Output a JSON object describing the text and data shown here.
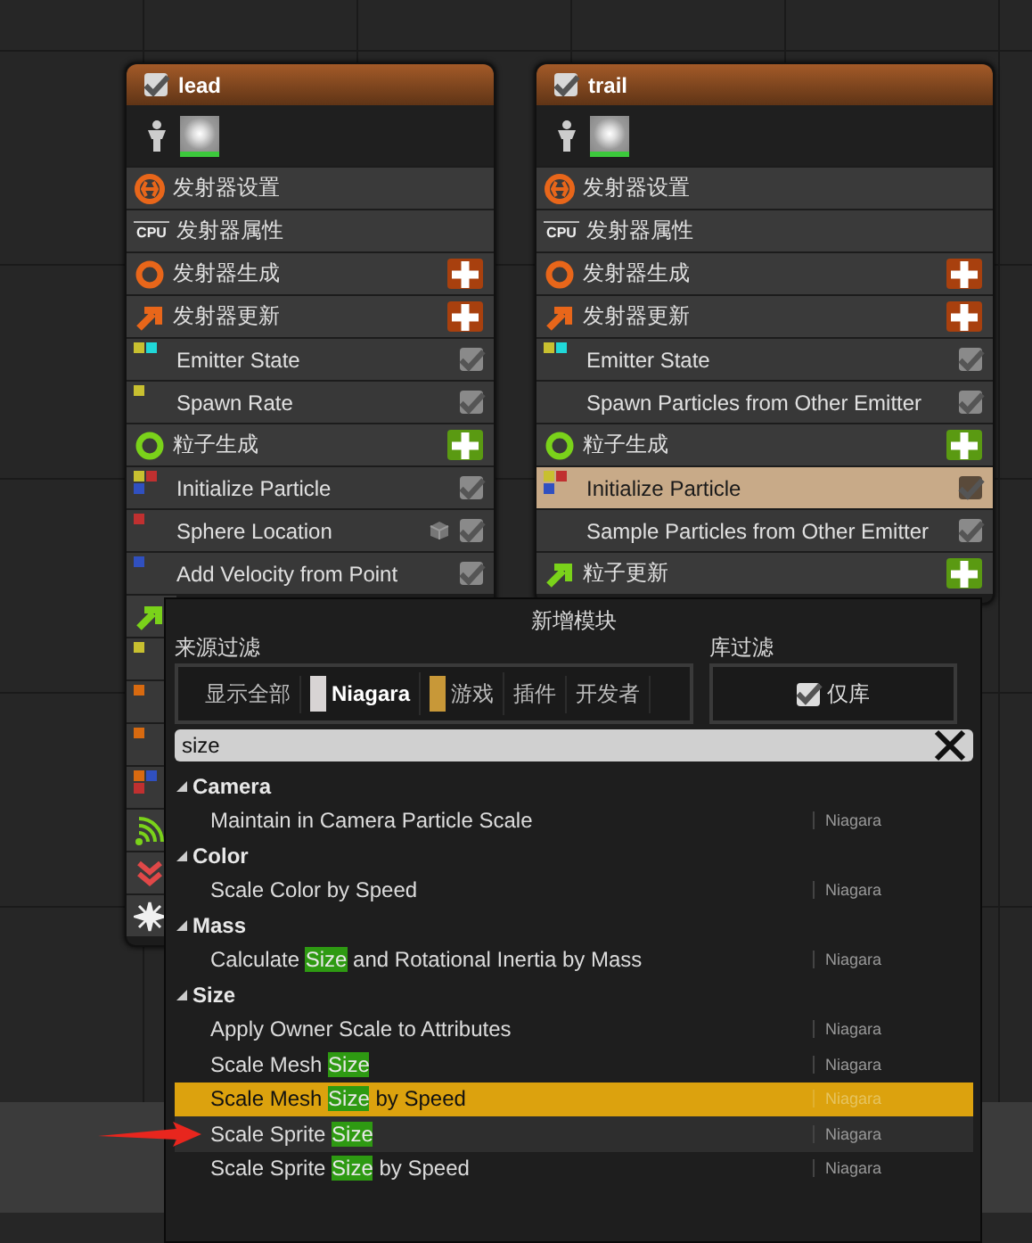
{
  "emitters": [
    {
      "name": "lead",
      "enabled": true,
      "rows": [
        {
          "kind": "settings",
          "label": "发射器设置",
          "color": "#e8661a"
        },
        {
          "kind": "properties",
          "badge": "CPU",
          "label": "发射器属性"
        },
        {
          "kind": "spawn",
          "label": "发射器生成",
          "color": "#e8661a",
          "add": true
        },
        {
          "kind": "update",
          "label": "发射器更新",
          "color": "#e8661a",
          "add": true
        },
        {
          "kind": "module",
          "label": "Emitter State",
          "dots": [
            {
              "color": "#c8c030"
            },
            {
              "color": "#20d8d8"
            }
          ],
          "checked": true
        },
        {
          "kind": "module",
          "label": "Spawn Rate",
          "dots": [
            {
              "color": "#c8c030"
            }
          ],
          "checked": true
        },
        {
          "kind": "spawn",
          "label": "粒子生成",
          "color": "#7ad21a",
          "add": true
        },
        {
          "kind": "module",
          "label": "Initialize Particle",
          "dots": [
            {
              "color": "#c8c030"
            },
            {
              "color": "#c03030"
            },
            {
              "color": "#3050c0"
            }
          ],
          "checked": true
        },
        {
          "kind": "module",
          "label": "Sphere Location",
          "dots": [
            {
              "color": "#c03030"
            }
          ],
          "checked": true,
          "mesh": true
        },
        {
          "kind": "module",
          "label": "Add Velocity from Point",
          "dots": [
            {
              "color": "#3050c0"
            }
          ],
          "checked": true
        },
        {
          "kind": "update",
          "color": "#7ad21a"
        },
        {
          "kind": "module",
          "dots": [
            {
              "color": "#c8c030"
            }
          ]
        },
        {
          "kind": "module",
          "dots": [
            {
              "color": "#d86a10"
            }
          ]
        },
        {
          "kind": "module",
          "dots": [
            {
              "color": "#d86a10"
            }
          ]
        },
        {
          "kind": "module",
          "dots": [
            {
              "color": "#d86a10"
            },
            {
              "color": "#3050c0"
            },
            {
              "color": "#c03030"
            }
          ]
        },
        {
          "kind": "sensor",
          "color": "#7ad21a"
        },
        {
          "kind": "chevron",
          "color": "#e04848"
        },
        {
          "kind": "burst",
          "color": "#f0f0f0"
        }
      ]
    },
    {
      "name": "trail",
      "enabled": true,
      "rows": [
        {
          "kind": "settings",
          "label": "发射器设置",
          "color": "#e8661a"
        },
        {
          "kind": "properties",
          "badge": "CPU",
          "label": "发射器属性"
        },
        {
          "kind": "spawn",
          "label": "发射器生成",
          "color": "#e8661a",
          "add": true
        },
        {
          "kind": "update",
          "label": "发射器更新",
          "color": "#e8661a",
          "add": true
        },
        {
          "kind": "module",
          "label": "Emitter State",
          "dots": [
            {
              "color": "#c8c030"
            },
            {
              "color": "#20d8d8"
            }
          ],
          "checked": true
        },
        {
          "kind": "module",
          "label": "Spawn Particles from Other Emitter",
          "checked": true
        },
        {
          "kind": "spawn",
          "label": "粒子生成",
          "color": "#7ad21a",
          "add": true
        },
        {
          "kind": "module",
          "label": "Initialize Particle",
          "dots": [
            {
              "color": "#c8c030"
            },
            {
              "color": "#c03030"
            },
            {
              "color": "#3050c0"
            }
          ],
          "checked": true,
          "selected": true
        },
        {
          "kind": "module",
          "label": "Sample Particles from Other Emitter",
          "checked": true
        },
        {
          "kind": "update",
          "label": "粒子更新",
          "color": "#7ad21a",
          "add": true
        }
      ]
    }
  ],
  "popup": {
    "title": "新增模块",
    "source_filter_label": "来源过滤",
    "library_filter_label": "库过滤",
    "source_filters": [
      {
        "label": "显示全部",
        "selected": false
      },
      {
        "label": "Niagara",
        "selected": true,
        "color": "#d8d4d4"
      },
      {
        "label": "游戏",
        "selected": false,
        "color": "#c89838"
      },
      {
        "label": "插件",
        "selected": false
      },
      {
        "label": "开发者",
        "selected": false
      }
    ],
    "library_only": {
      "label": "仅库",
      "checked": true
    },
    "search": {
      "value": "size"
    },
    "categories": [
      {
        "name": "Camera",
        "expanded": true,
        "items": [
          {
            "name": [
              {
                "text": "Maintain in Camera Particle Scale"
              }
            ],
            "source": "Niagara",
            "selected": false,
            "hovered": false
          }
        ]
      },
      {
        "name": "Color",
        "expanded": true,
        "items": [
          {
            "name": [
              {
                "text": "Scale Color by Speed"
              }
            ],
            "source": "Niagara",
            "selected": false,
            "hovered": false
          }
        ]
      },
      {
        "name": "Mass",
        "expanded": true,
        "items": [
          {
            "name": [
              {
                "text": "Calculate "
              },
              {
                "text": "Size",
                "match": true
              },
              {
                "text": " and Rotational Inertia by Mass"
              }
            ],
            "source": "Niagara",
            "selected": false,
            "hovered": false
          }
        ]
      },
      {
        "name": "Size",
        "expanded": true,
        "items": [
          {
            "name": [
              {
                "text": "Apply Owner Scale to Attributes"
              }
            ],
            "source": "Niagara",
            "selected": false,
            "hovered": false
          },
          {
            "name": [
              {
                "text": "Scale Mesh "
              },
              {
                "text": "Size",
                "match": true
              }
            ],
            "source": "Niagara",
            "selected": false,
            "hovered": false
          },
          {
            "name": [
              {
                "text": "Scale Mesh "
              },
              {
                "text": "Size",
                "match": true
              },
              {
                "text": " by Speed"
              }
            ],
            "source": "Niagara",
            "selected": true,
            "hovered": false
          },
          {
            "name": [
              {
                "text": "Scale Sprite "
              },
              {
                "text": "Size",
                "match": true
              }
            ],
            "source": "Niagara",
            "selected": false,
            "hovered": true
          },
          {
            "name": [
              {
                "text": "Scale Sprite "
              },
              {
                "text": "Size",
                "match": true
              },
              {
                "text": " by Speed"
              }
            ],
            "source": "Niagara",
            "selected": false,
            "hovered": false
          }
        ]
      }
    ]
  }
}
